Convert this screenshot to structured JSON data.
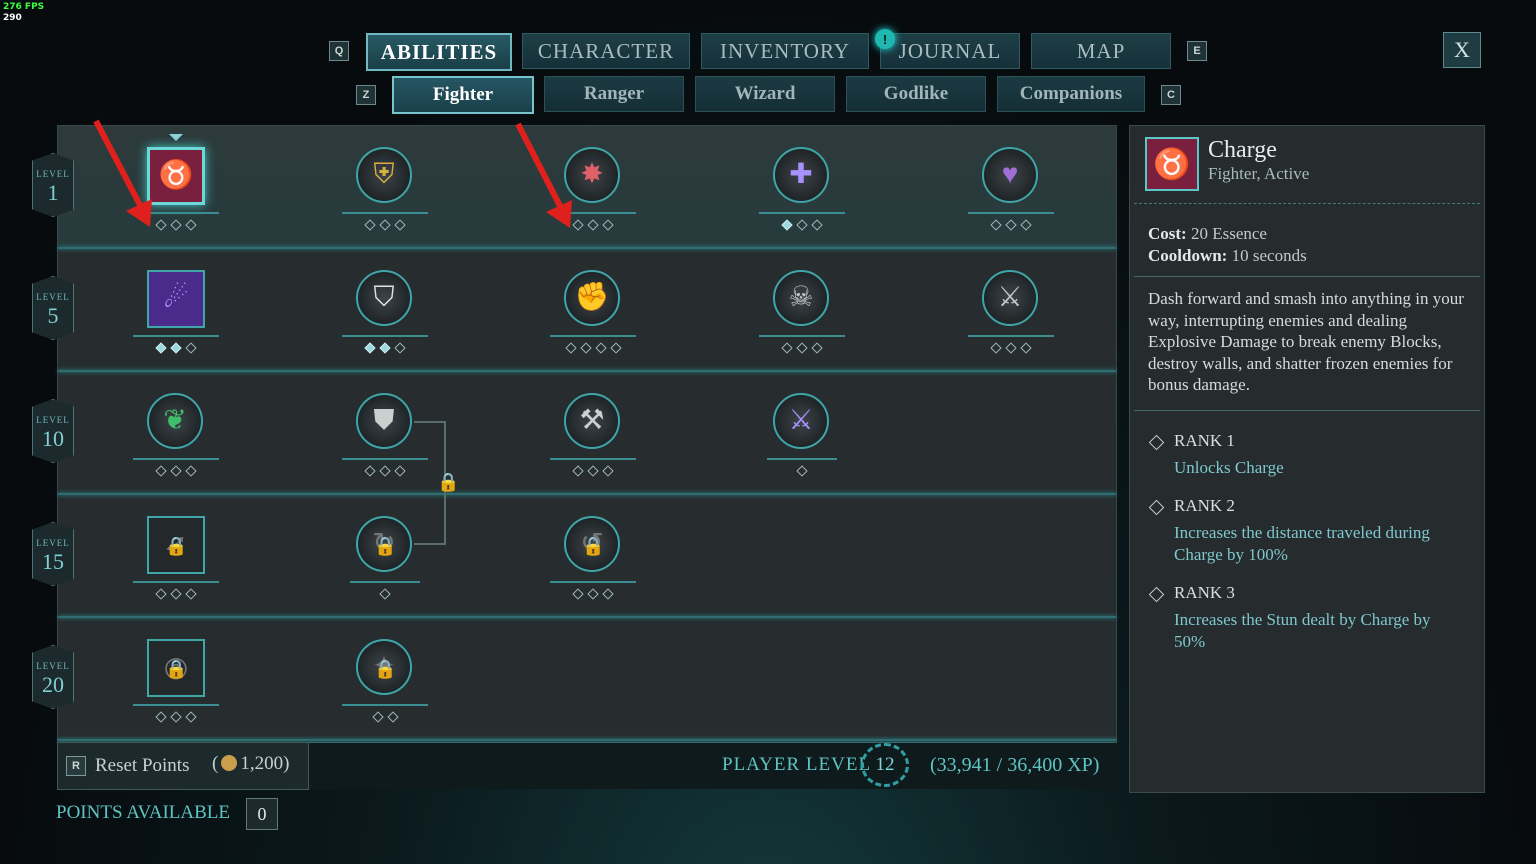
{
  "fps": {
    "label": "276 FPS",
    "value": "290"
  },
  "keys": {
    "q": "Q",
    "e": "E",
    "z": "Z",
    "c": "C",
    "r": "R"
  },
  "main_tabs": [
    "ABILITIES",
    "CHARACTER",
    "INVENTORY",
    "JOURNAL",
    "MAP"
  ],
  "notification": "!",
  "close_label": "X",
  "sub_tabs": [
    "Fighter",
    "Ranger",
    "Wizard",
    "Godlike",
    "Companions"
  ],
  "levels": [
    {
      "label": "LEVEL",
      "num": "1"
    },
    {
      "label": "LEVEL",
      "num": "5"
    },
    {
      "label": "LEVEL",
      "num": "10"
    },
    {
      "label": "LEVEL",
      "num": "15"
    },
    {
      "label": "LEVEL",
      "num": "20"
    }
  ],
  "abilities": [
    {
      "icon": "bull-head-icon",
      "glyph": "♉",
      "shape": "square",
      "ranks": 3,
      "filled": 0,
      "color": "#d9566f",
      "bg": "#7a1f3d"
    },
    {
      "icon": "golden-shield-icon",
      "glyph": "⛨",
      "shape": "circle",
      "ranks": 3,
      "filled": 0,
      "color": "#d8b040"
    },
    {
      "icon": "shield-bash-icon",
      "glyph": "✸",
      "shape": "circle",
      "ranks": 3,
      "filled": 0,
      "color": "#e0606a"
    },
    {
      "icon": "plus-cross-icon",
      "glyph": "✚",
      "shape": "circle",
      "ranks": 3,
      "filled": 1,
      "color": "#a890ff"
    },
    {
      "icon": "heart-icon",
      "glyph": "♥",
      "shape": "circle",
      "ranks": 3,
      "filled": 0,
      "color": "#a070d8"
    },
    {
      "icon": "purple-strike-icon",
      "glyph": "☄",
      "shape": "square",
      "ranks": 3,
      "filled": 2,
      "color": "#b89bff",
      "bg": "#4a2a8a"
    },
    {
      "icon": "broken-shield-icon",
      "glyph": "⛉",
      "shape": "circle",
      "ranks": 3,
      "filled": 2,
      "color": "#dde4e4"
    },
    {
      "icon": "fist-icon",
      "glyph": "✊",
      "shape": "circle",
      "ranks": 4,
      "filled": 0,
      "color": "#d0d6d6"
    },
    {
      "icon": "skull-sword-icon",
      "glyph": "☠",
      "shape": "circle",
      "ranks": 3,
      "filled": 0,
      "color": "#c0c8c8"
    },
    {
      "icon": "battle-axe-icon",
      "glyph": "⚔",
      "shape": "circle",
      "ranks": 3,
      "filled": 0,
      "color": "#c0c8c8"
    },
    {
      "icon": "green-claw-icon",
      "glyph": "❦",
      "shape": "circle",
      "ranks": 3,
      "filled": 0,
      "color": "#3fbf6c"
    },
    {
      "icon": "sword-shield-icon",
      "glyph": "⛊",
      "shape": "circle",
      "ranks": 3,
      "filled": 0,
      "color": "#c8d0d0"
    },
    {
      "icon": "whirl-hammer-icon",
      "glyph": "⚒",
      "shape": "circle",
      "ranks": 3,
      "filled": 0,
      "color": "#c8d0d0"
    },
    {
      "icon": "crossed-swords-icon",
      "glyph": "⚔",
      "shape": "circle",
      "ranks": 1,
      "filled": 0,
      "color": "#a890ff"
    },
    {
      "icon": "locked-arrow-icon",
      "glyph": "➹",
      "shape": "square",
      "ranks": 3,
      "filled": 0,
      "color": "#777",
      "locked": true
    },
    {
      "icon": "locked-spiral-icon",
      "glyph": "↻",
      "shape": "circle",
      "ranks": 1,
      "filled": 0,
      "color": "#777",
      "locked": true
    },
    {
      "icon": "locked-swirl-icon",
      "glyph": "↺",
      "shape": "circle",
      "ranks": 3,
      "filled": 0,
      "color": "#777",
      "locked": true
    },
    {
      "icon": "locked-vortex-icon",
      "glyph": "◎",
      "shape": "square",
      "ranks": 3,
      "filled": 0,
      "color": "#777",
      "locked": true
    },
    {
      "icon": "locked-figure-icon",
      "glyph": "✦",
      "shape": "circle",
      "ranks": 2,
      "filled": 0,
      "color": "#777",
      "locked": true
    }
  ],
  "reset": {
    "label": "Reset Points",
    "open": "(",
    "cost": "1,200",
    "close": ")"
  },
  "player_level": {
    "label": "PLAYER LEVEL",
    "level": "12",
    "xp": "(33,941 / 36,400 XP)"
  },
  "points": {
    "label": "POINTS AVAILABLE",
    "value": "0"
  },
  "detail": {
    "name": "Charge",
    "subtitle": "Fighter, Active",
    "cost_label": "Cost:",
    "cost_value": "20 Essence",
    "cooldown_label": "Cooldown:",
    "cooldown_value": "10 seconds",
    "description": "Dash forward and smash into anything in your way, interrupting enemies and dealing Explosive Damage to break enemy Blocks, destroy walls, and shatter frozen enemies for bonus damage.",
    "ranks": [
      {
        "title": "RANK 1",
        "text": "Unlocks Charge"
      },
      {
        "title": "RANK 2",
        "text": "Increases the distance traveled during Charge by 100%"
      },
      {
        "title": "RANK 3",
        "text": "Increases the Stun dealt by Charge by 50%"
      }
    ]
  },
  "colors": {
    "accent": "#3fa5a8",
    "highlight": "#5ec4c4",
    "lock": "#e39a3a",
    "arrow": "#e0201c"
  }
}
